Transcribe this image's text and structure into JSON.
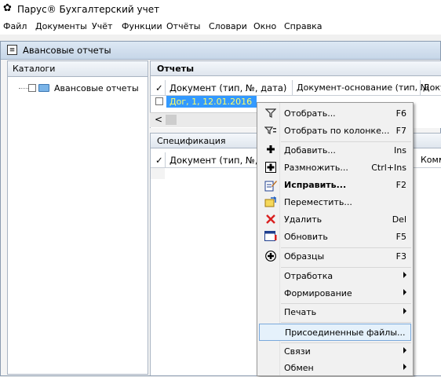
{
  "window": {
    "title": "Парус® Бухгалтерский учет"
  },
  "menubar": [
    "Файл",
    "Документы",
    "Учёт",
    "Функции",
    "Отчёты",
    "Словари",
    "Окно",
    "Справка"
  ],
  "doc_window": {
    "title": "Авансовые отчеты"
  },
  "catalog": {
    "header": "Каталоги",
    "items": [
      {
        "label": "Авансовые отчеты"
      }
    ]
  },
  "reports": {
    "header": "Отчеты",
    "check_col": "✓",
    "columns": [
      "Документ (тип, №, дата)",
      "Документ-основание (тип, №",
      "Доку"
    ],
    "rows": [
      {
        "doc": "Дог, 1, 12.01.2016"
      }
    ],
    "scroll_left": "<"
  },
  "spec": {
    "header": "Спецификация",
    "check_col": "✓",
    "columns": [
      "Документ (тип, №,",
      "Комм"
    ]
  },
  "context_menu": {
    "items": [
      {
        "label": "Отобрать...",
        "shortcut": "F6",
        "icon": "filter-icon"
      },
      {
        "label": "Отобрать по колонке...",
        "shortcut": "F7",
        "icon": "filter-column-icon"
      },
      {
        "sep": true
      },
      {
        "label": "Добавить...",
        "shortcut": "Ins",
        "icon": "plus-icon"
      },
      {
        "label": "Размножить...",
        "shortcut": "Ctrl+Ins",
        "icon": "duplicate-icon"
      },
      {
        "label": "Исправить...",
        "shortcut": "F2",
        "icon": "edit-icon",
        "bold": true
      },
      {
        "label": "Переместить...",
        "shortcut": "",
        "icon": "move-icon"
      },
      {
        "label": "Удалить",
        "shortcut": "Del",
        "icon": "delete-icon"
      },
      {
        "label": "Обновить",
        "shortcut": "F5",
        "icon": "refresh-icon"
      },
      {
        "sep": true
      },
      {
        "label": "Образцы",
        "shortcut": "F3",
        "icon": "templates-icon"
      },
      {
        "sep": true
      },
      {
        "label": "Отработка",
        "submenu": true
      },
      {
        "label": "Формирование",
        "submenu": true
      },
      {
        "sep": true
      },
      {
        "label": "Печать",
        "submenu": true
      },
      {
        "sep": true
      },
      {
        "label": "Присоединенные файлы...",
        "highlighted": true
      },
      {
        "sep": true
      },
      {
        "label": "Связи",
        "submenu": true
      },
      {
        "label": "Обмен",
        "submenu": true
      }
    ]
  },
  "colors": {
    "selection": "#3399ff",
    "menu_highlight": "#e5f1fb",
    "delete_icon": "#d92020",
    "selected_row_text": "#ffff66"
  }
}
